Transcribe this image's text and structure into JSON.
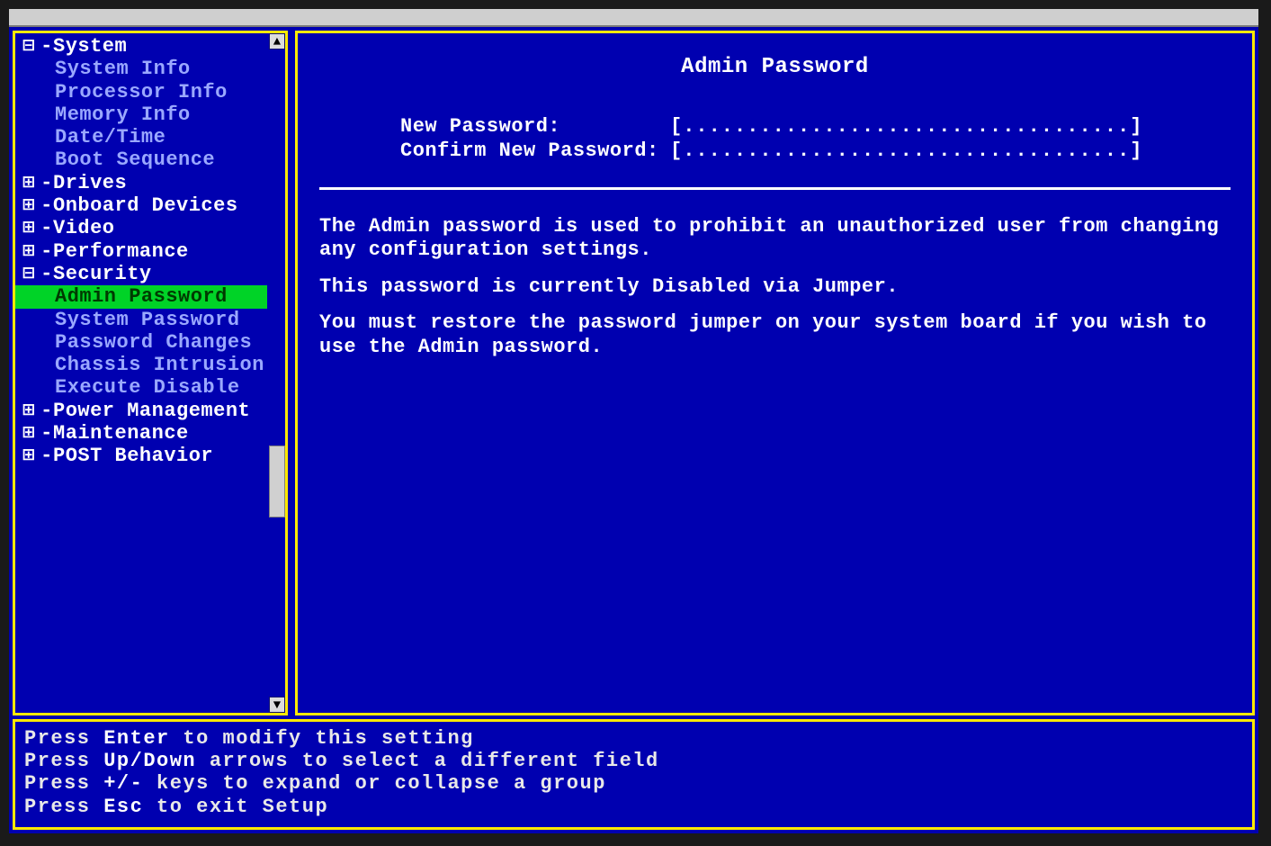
{
  "tree": {
    "system": {
      "label": "System",
      "children": [
        "System Info",
        "Processor Info",
        "Memory Info",
        "Date/Time",
        "Boot Sequence"
      ]
    },
    "drives": "Drives",
    "onboard_devices": "Onboard Devices",
    "video": "Video",
    "performance": "Performance",
    "security": {
      "label": "Security",
      "children": [
        "Admin Password",
        "System Password",
        "Password Changes",
        "Chassis Intrusion",
        "Execute Disable"
      ]
    },
    "power_management": "Power Management",
    "maintenance": "Maintenance",
    "post_behavior": "POST Behavior"
  },
  "panel": {
    "title": "Admin Password",
    "new_password_label": "New Password:",
    "confirm_password_label": "Confirm New Password:",
    "field_placeholder": "[...................................]",
    "desc1": "The Admin password is used to prohibit an unauthorized user from changing any configuration settings.",
    "desc2_pre": "This password is currently ",
    "desc2_bold": "Disabled via Jumper",
    "desc2_post": ".",
    "desc3": "You must restore the password jumper on your system board if you wish to use the Admin password."
  },
  "footer": {
    "l1_a": "Press ",
    "l1_b": "Enter",
    "l1_c": " to modify this setting",
    "l2_a": "Press ",
    "l2_b": "Up/Down",
    "l2_c": " arrows to select a different field",
    "l3_a": "Press ",
    "l3_b": "+/-",
    "l3_c": " keys to expand or collapse a group",
    "l4_a": "Press ",
    "l4_b": "Esc",
    "l4_c": " to exit Setup"
  }
}
